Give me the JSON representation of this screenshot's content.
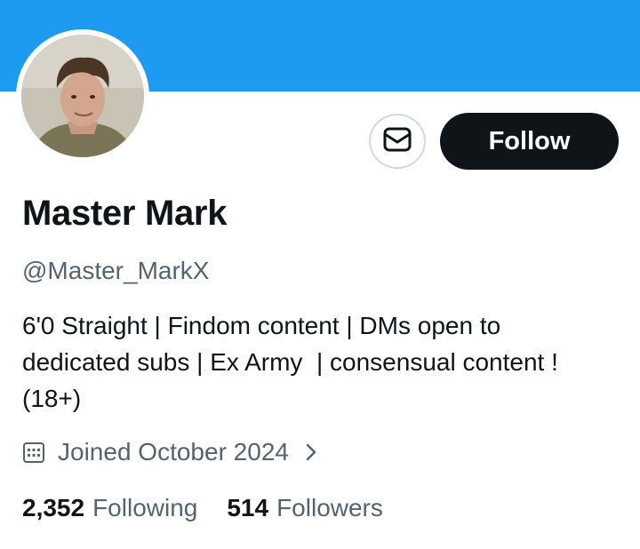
{
  "profile": {
    "display_name": "Master Mark",
    "handle": "@Master_MarkX",
    "bio": "6'0 Straight | Findom content | DMs open to\ndedicated subs | Ex Army  | consensual content !\n(18+)",
    "joined": "Joined October 2024"
  },
  "actions": {
    "follow_label": "Follow",
    "message_icon": "envelope-icon"
  },
  "stats": {
    "following_count": "2,352",
    "following_label": "Following",
    "followers_count": "514",
    "followers_label": "Followers"
  },
  "colors": {
    "banner": "#1d9bf0",
    "primary_text": "#0f1419",
    "secondary_text": "#536471",
    "follow_bg": "#0f1419",
    "follow_text": "#ffffff"
  },
  "icons": {
    "calendar": "calendar-icon",
    "chevron": "chevron-right-icon"
  }
}
